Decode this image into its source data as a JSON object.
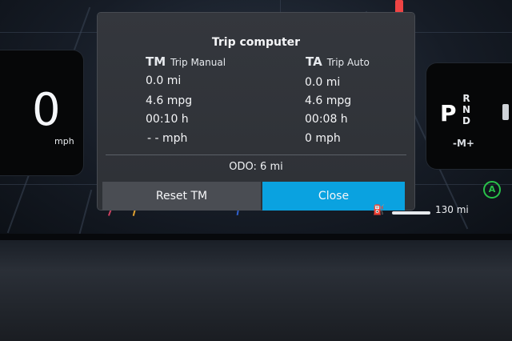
{
  "dialog": {
    "title": "Trip computer",
    "trip_manual": {
      "abbr": "TM",
      "label": "Trip Manual",
      "distance": "0.0 mi",
      "economy": "4.6 mpg",
      "time": "00:10 h",
      "speed": "- - mph"
    },
    "trip_auto": {
      "abbr": "TA",
      "label": "Trip Auto",
      "distance": "0.0 mi",
      "economy": "4.6 mpg",
      "time": "00:08 h",
      "speed": "0 mph"
    },
    "odo": "ODO:  6 mi",
    "reset_label": "Reset TM",
    "close_label": "Close"
  },
  "speedometer": {
    "value": "0",
    "unit": "mph"
  },
  "gear": {
    "selected": "P",
    "options": [
      "R",
      "N",
      "D"
    ],
    "mode": "-M+"
  },
  "range": {
    "value": "130 mi",
    "icon": "fuel-pump-icon"
  },
  "colors": {
    "accent": "#0aa2e0",
    "dialog_bg": "#313439",
    "reset_bg": "#4a4d53",
    "auto_indicator": "#29c24a"
  }
}
